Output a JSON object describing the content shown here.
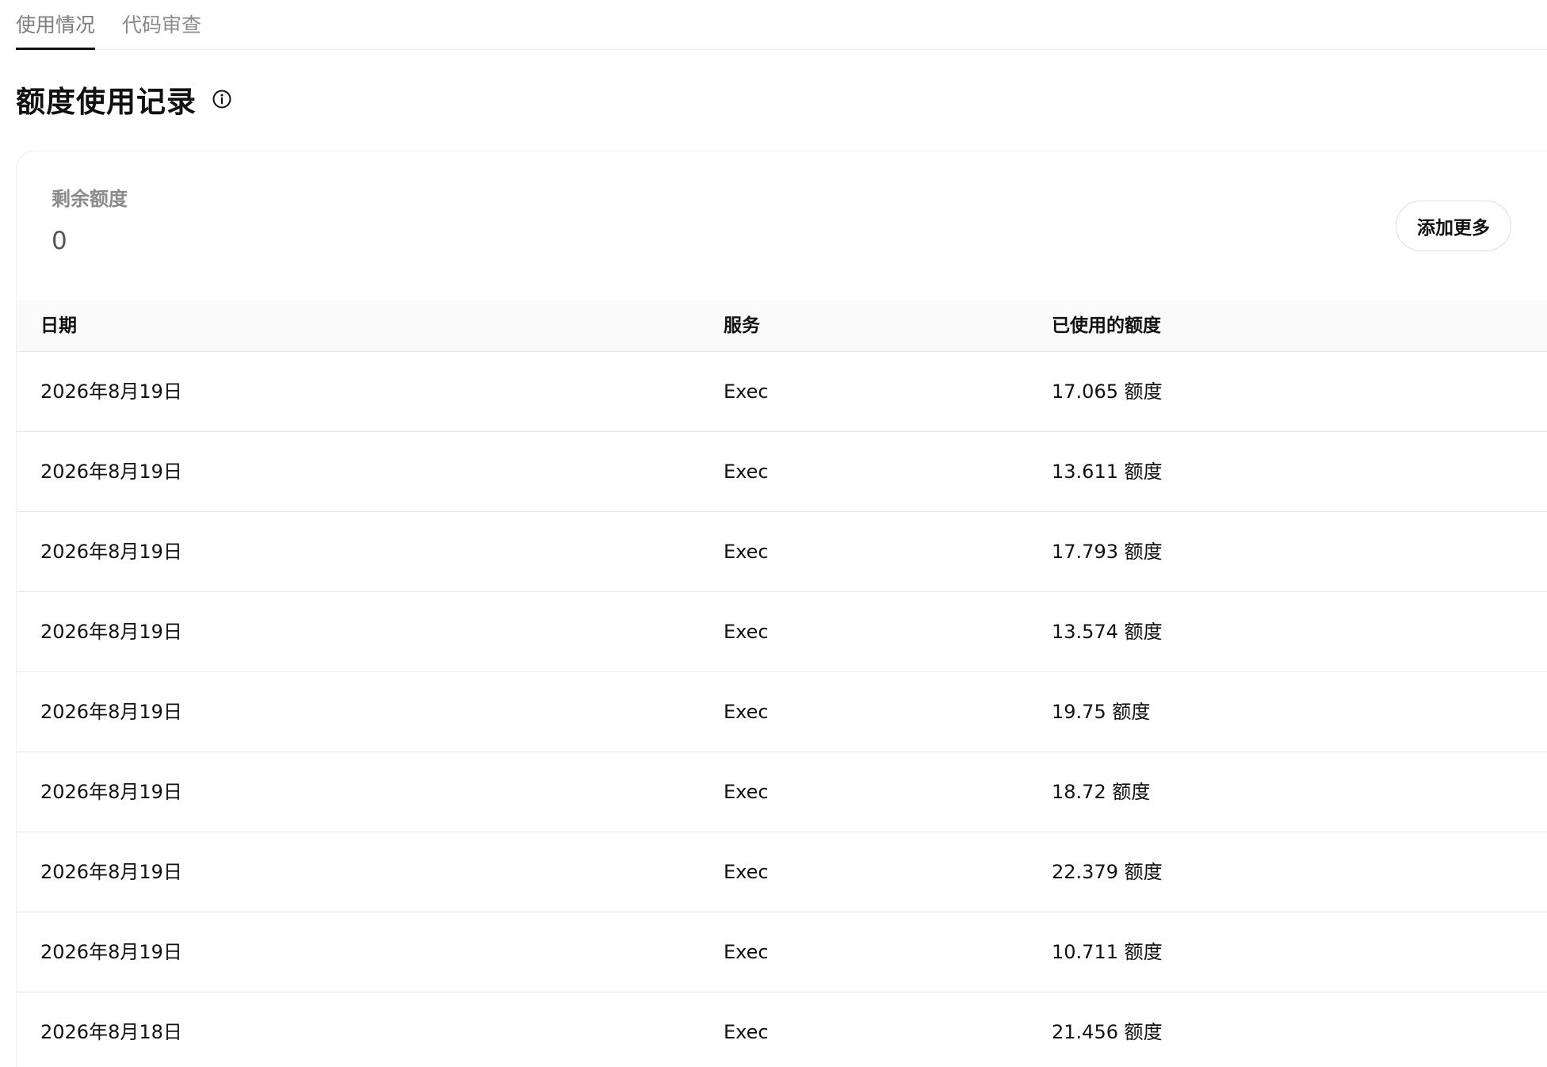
{
  "tabs": [
    {
      "label": "使用情况",
      "active": true
    },
    {
      "label": "代码审查",
      "active": false
    }
  ],
  "heading": {
    "title": "额度使用记录",
    "info_icon": "info-circle-icon"
  },
  "summary": {
    "label": "剩余额度",
    "value": "0",
    "add_more_label": "添加更多"
  },
  "table": {
    "columns": [
      "日期",
      "服务",
      "已使用的额度"
    ],
    "rows": [
      {
        "date": "2026年8月19日",
        "service": "Exec",
        "credits": "17.065 额度"
      },
      {
        "date": "2026年8月19日",
        "service": "Exec",
        "credits": "13.611 额度"
      },
      {
        "date": "2026年8月19日",
        "service": "Exec",
        "credits": "17.793 额度"
      },
      {
        "date": "2026年8月19日",
        "service": "Exec",
        "credits": "13.574 额度"
      },
      {
        "date": "2026年8月19日",
        "service": "Exec",
        "credits": "19.75 额度"
      },
      {
        "date": "2026年8月19日",
        "service": "Exec",
        "credits": "18.72 额度"
      },
      {
        "date": "2026年8月19日",
        "service": "Exec",
        "credits": "22.379 额度"
      },
      {
        "date": "2026年8月19日",
        "service": "Exec",
        "credits": "10.711 额度"
      },
      {
        "date": "2026年8月18日",
        "service": "Exec",
        "credits": "21.456 额度"
      }
    ]
  }
}
